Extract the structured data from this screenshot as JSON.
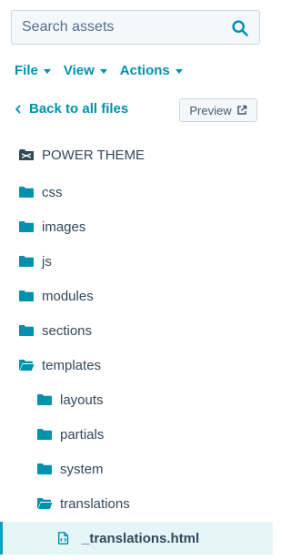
{
  "search": {
    "placeholder": "Search assets"
  },
  "menubar": {
    "file": "File",
    "view": "View",
    "actions": "Actions"
  },
  "nav": {
    "back_label": "Back to all files",
    "preview_label": "Preview"
  },
  "tree": {
    "root": "POWER THEME",
    "folders": {
      "css": "css",
      "images": "images",
      "js": "js",
      "modules": "modules",
      "sections": "sections",
      "templates": "templates",
      "layouts": "layouts",
      "partials": "partials",
      "system": "system",
      "translations": "translations"
    },
    "selected_file": "_translations.html"
  },
  "colors": {
    "accent": "#0091ae",
    "icon": "#0091ae",
    "selected_bg": "#e5f5f8",
    "selected_border": "#00a4bd",
    "text": "#33475b"
  }
}
